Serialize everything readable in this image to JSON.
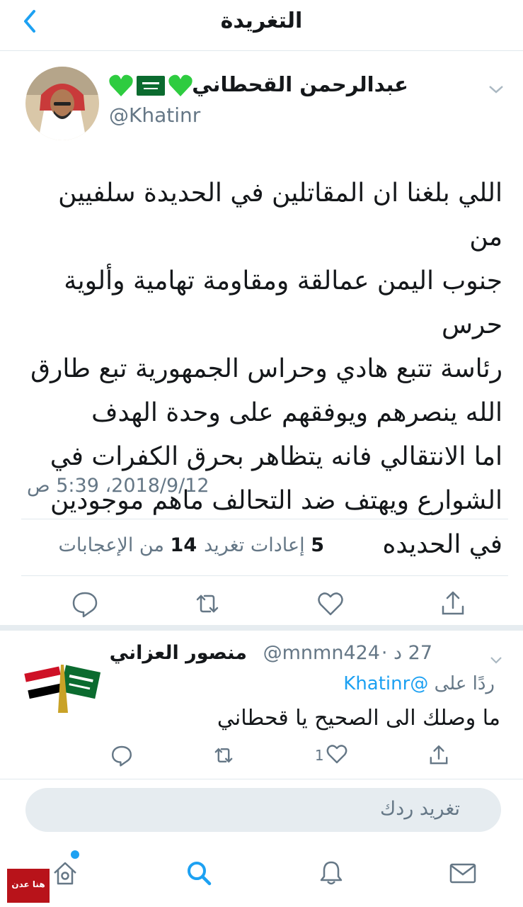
{
  "header": {
    "title": "التغريدة"
  },
  "tweet": {
    "display_name": "عبدالرحمن القحطاني",
    "handle": "@Khatinr",
    "text_lines": [
      "اللي بلغنا ان المقاتلين في الحديدة سلفيين من",
      "جنوب اليمن عمالقة ومقاومة تهامية وألوية حرس",
      "رئاسة تتبع هادي وحراس الجمهورية تبع طارق",
      "الله ينصرهم ويوفقهم على وحدة الهدف",
      "اما الانتقالي فانه يتظاهر بحرق الكفرات في",
      "الشوارع ويهتف ضد التحالف ماهم موجودين",
      "في الحديده"
    ],
    "datetime": "2018/9/12، 5:39 ص",
    "likes_count": "14",
    "likes_label": "من الإعجابات",
    "retweets_count": "5",
    "retweets_label": "إعادات تغريد"
  },
  "reply": {
    "display_name": "منصور العزاني",
    "handle": "@mnmn424",
    "time": "27 د ·",
    "replying_prefix": "ردًا على",
    "replying_to": "@Khatinr",
    "text": "ما وصلك الى الصحيح يا قحطاني",
    "like_count": "1"
  },
  "compose": {
    "placeholder": "تغريد ردك"
  },
  "watermark": {
    "text": "هنا عدن"
  },
  "colors": {
    "accent": "#1da1f2",
    "secondary_text": "#657786",
    "emoji_heart": "#2ecc40",
    "flag_saudi": "#0b6b2f"
  },
  "icons": [
    "back-chevron-icon",
    "caret-down-icon",
    "reply-icon",
    "retweet-icon",
    "like-icon",
    "share-icon",
    "home-icon",
    "search-icon",
    "notifications-icon",
    "messages-icon"
  ]
}
